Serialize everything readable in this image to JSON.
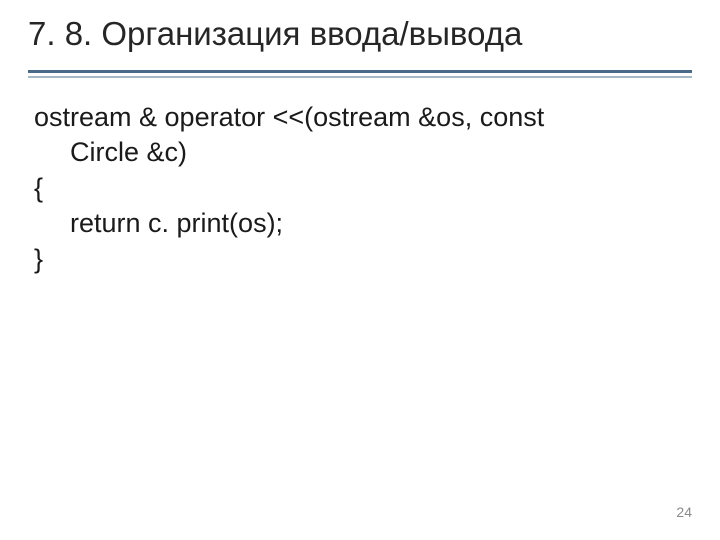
{
  "slide": {
    "title": "7. 8. Организация ввода/вывода",
    "page_number": "24"
  },
  "code": {
    "l1": "ostream & operator <<(ostream &os, const",
    "l2": "Circle &c)",
    "l3": "{",
    "l4": "return c. print(os);",
    "l5": "}"
  }
}
